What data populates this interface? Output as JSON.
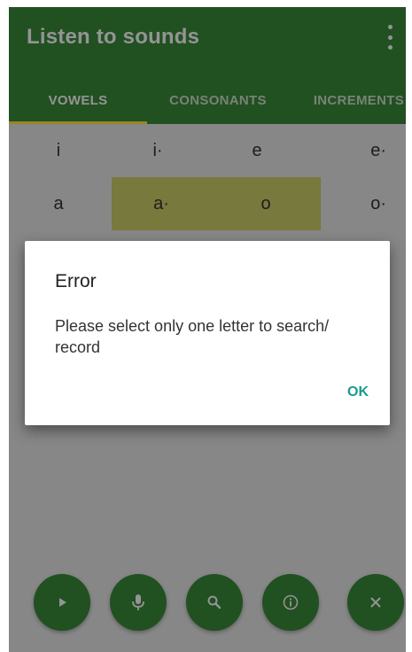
{
  "app": {
    "title": "Listen to sounds",
    "colors": {
      "primary": "#3a8a3a",
      "selected_cell": "#cfd06a",
      "tab_indicator": "#ffeb3b",
      "dialog_action": "#1a9a8a"
    },
    "overflow_icon": "more-vert-icon"
  },
  "tabs": [
    {
      "label": "VOWELS",
      "active": true
    },
    {
      "label": "CONSONANTS",
      "active": false
    },
    {
      "label": "INCREMENTS",
      "active": false
    }
  ],
  "letters": [
    [
      "i",
      "i·",
      "e",
      "e·"
    ],
    [
      "a",
      "a·",
      "o",
      "o·"
    ]
  ],
  "selected_letters": [
    "a·",
    "o"
  ],
  "dialog": {
    "title": "Error",
    "message": "Please select only one letter to search/ record",
    "ok_label": "OK"
  },
  "actions": [
    {
      "name": "play-button",
      "icon": "play-icon"
    },
    {
      "name": "record-button",
      "icon": "microphone-icon"
    },
    {
      "name": "search-button",
      "icon": "search-icon"
    },
    {
      "name": "info-button",
      "icon": "info-icon"
    },
    {
      "name": "clear-button",
      "icon": "close-icon"
    }
  ]
}
